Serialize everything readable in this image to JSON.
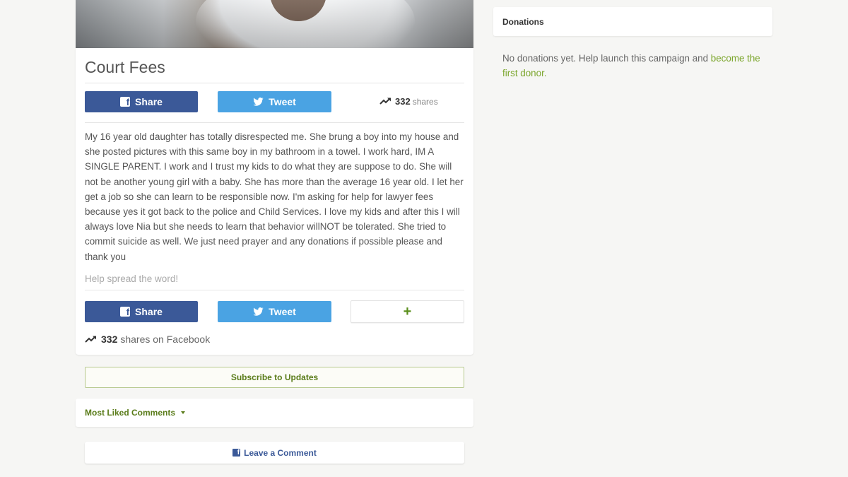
{
  "campaign": {
    "title": "Court Fees",
    "story": "My 16 year old daughter has totally disrespected me. She brung a boy into my house and she posted pictures with this same boy in my bathroom in a towel. I work hard, IM A SINGLE PARENT. I work and I trust my kids to do what they are suppose to do. She will not be another young girl with a baby. She has more than the average 16 year old. I let her get a job so she can learn to be responsible now. I'm asking for help for lawyer fees because yes it got back to the police and Child Services. I love my kids and after this I will always love Nia but she needs to learn that behavior willNOT be tolerated. She tried to commit suicide as well. We just need prayer and any donations if possible please and thank you",
    "spread_text": "Help spread the word!"
  },
  "share_top": {
    "share_label": "Share",
    "tweet_label": "Tweet",
    "count": "332",
    "count_label": "shares"
  },
  "share_bottom": {
    "share_label": "Share",
    "tweet_label": "Tweet",
    "more_label": "+",
    "count": "332",
    "count_label": "shares on Facebook"
  },
  "updates": {
    "subscribe_label": "Subscribe to Updates"
  },
  "comments": {
    "toggle_label": "Most Liked Comments",
    "leave_label": "Leave a Comment"
  },
  "donations": {
    "title": "Donations",
    "empty_text": "No donations yet. Help launch this campaign and ",
    "empty_link": "become the first donor",
    "empty_end": "."
  },
  "colors": {
    "facebook": "#3b5998",
    "twitter": "#4aa3e3",
    "accent_green": "#5a7c1a",
    "link_green": "#7aa52a"
  },
  "icons": {
    "facebook": "facebook-icon",
    "twitter": "twitter-icon",
    "trending": "trending-up-icon",
    "plus": "plus-icon",
    "caret": "caret-down-icon"
  }
}
